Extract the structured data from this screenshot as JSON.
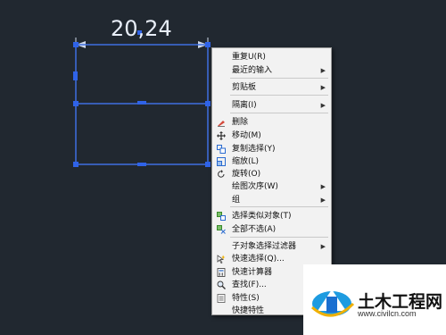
{
  "drawing": {
    "dimension_text": "20,24"
  },
  "context_menu": {
    "items": [
      {
        "label": "重复U(R)",
        "submenu": false,
        "icon": ""
      },
      {
        "label": "最近的输入",
        "submenu": true,
        "icon": ""
      },
      {
        "label": "剪贴板",
        "submenu": true,
        "icon": ""
      },
      {
        "label": "隔离(I)",
        "submenu": true,
        "icon": ""
      },
      {
        "label": "删除",
        "submenu": false,
        "icon": "eraser-icon"
      },
      {
        "label": "移动(M)",
        "submenu": false,
        "icon": "move-icon"
      },
      {
        "label": "复制选择(Y)",
        "submenu": false,
        "icon": "copy-selection-icon"
      },
      {
        "label": "缩放(L)",
        "submenu": false,
        "icon": "scale-icon"
      },
      {
        "label": "旋转(O)",
        "submenu": false,
        "icon": "rotate-icon"
      },
      {
        "label": "绘图次序(W)",
        "submenu": true,
        "icon": ""
      },
      {
        "label": "组",
        "submenu": true,
        "icon": ""
      },
      {
        "label": "选择类似对象(T)",
        "submenu": false,
        "icon": "select-similar-icon"
      },
      {
        "label": "全部不选(A)",
        "submenu": false,
        "icon": "deselect-all-icon"
      },
      {
        "label": "子对象选择过滤器",
        "submenu": true,
        "icon": ""
      },
      {
        "label": "快速选择(Q)...",
        "submenu": false,
        "icon": "quick-select-icon"
      },
      {
        "label": "快速计算器",
        "submenu": false,
        "icon": "calculator-icon"
      },
      {
        "label": "查找(F)...",
        "submenu": false,
        "icon": "find-icon"
      },
      {
        "label": "特性(S)",
        "submenu": false,
        "icon": "properties-icon"
      },
      {
        "label": "快捷特性",
        "submenu": false,
        "icon": ""
      }
    ]
  },
  "watermark": {
    "name": "土木工程网",
    "url": "www.civilcn.com"
  },
  "colors": {
    "background": "#212830",
    "selection": "#3f6fe0",
    "arrow": "#e0202a"
  }
}
